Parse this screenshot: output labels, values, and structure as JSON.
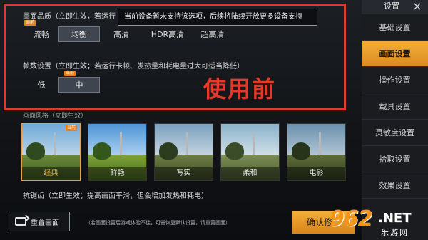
{
  "quality": {
    "label": "画面品质（立即生效，若运行",
    "tag": "当前",
    "tooltip": "当前设备暂未支持该选项，后续将陆续开放更多设备支持",
    "options": [
      "流畅",
      "均衡",
      "高清",
      "HDR高清",
      "超高清"
    ],
    "selected": "均衡"
  },
  "fps": {
    "label": "帧数设置（立即生效；若运行卡顿、发热量和耗电量过大可适当降低）",
    "tag": "当前",
    "options": [
      "低",
      "中"
    ],
    "selected": "中"
  },
  "overlay_text": "使用前",
  "styles": {
    "label": "画面风格（立即生效）",
    "items": [
      "经典",
      "鲜艳",
      "写实",
      "柔和",
      "电影"
    ],
    "selected": "经典",
    "badge": "当前"
  },
  "antialias_label": "抗锯齿（立即生效；提高画面平滑，但会增加发热和耗电）",
  "reset_label": "重置画面",
  "note": "（若画面设置后游戏体验不佳，可需恢复默认设置，请重置画面）",
  "confirm_label": "确认修",
  "sidebar": {
    "title": "设置",
    "close": "×",
    "items": [
      "基础设置",
      "画面设置",
      "操作设置",
      "载具设置",
      "灵敏度设置",
      "拾取设置",
      "效果设置"
    ],
    "active": "画面设置"
  },
  "watermark": {
    "number": "962",
    "net": ".NET",
    "cn": "乐游网"
  },
  "colors": {
    "accent": "#e2801c",
    "highlight_red": "#e03a2a"
  }
}
